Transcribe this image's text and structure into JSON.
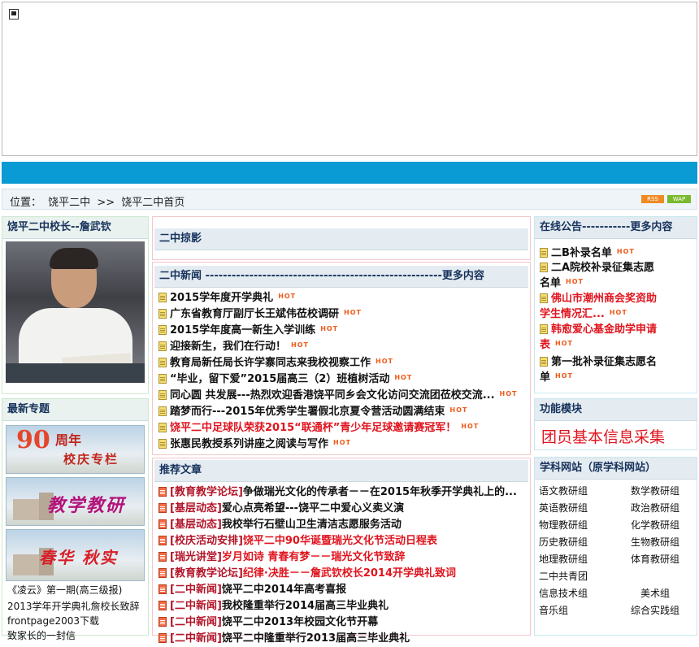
{
  "breadcrumb": {
    "label": "位置：",
    "home": "饶平二中",
    "sep": ">>",
    "current": "饶平二中首页"
  },
  "badges": {
    "rss": "RSS",
    "wap": "WAP"
  },
  "left": {
    "principal_title": "饶平二中校长--詹武钦",
    "special_title": "最新专题",
    "banners": [
      {
        "big": "90",
        "small": "周年",
        "small2": "校庆专栏"
      },
      {
        "text": "教学教研"
      },
      {
        "text": "春华 秋实"
      }
    ],
    "links": [
      "《凌云》第一期(高三级报)",
      "2013学年开学典礼詹校长致辞",
      "frontpage2003下载",
      "致家长的一封信"
    ]
  },
  "middle": {
    "photo_title": "二中掠影",
    "news_title": "二中新闻  ------------------------------------------------------更多内容",
    "hot": "HOT",
    "news": [
      {
        "text": "2015学年度开学典礼",
        "red": false
      },
      {
        "text": "广东省教育厅副厅长王斌伟莅校调研",
        "red": false
      },
      {
        "text": "2015学年度高一新生入学训练",
        "red": false
      },
      {
        "text": "迎接新生，我们在行动！",
        "red": false
      },
      {
        "text": "教育局新任局长许学寨同志来我校视察工作",
        "red": false
      },
      {
        "text": "“毕业，留下爱”2015届高三（2）班植树活动",
        "red": false
      },
      {
        "text": "同心圆 共发展---热烈欢迎香港饶平同乡会文化访问交流团莅校交流...",
        "red": false
      },
      {
        "text": "踏梦而行---2015年优秀学生署假北京夏令营活动圆满结束",
        "red": false
      },
      {
        "text": "饶平二中足球队荣获2015“联通杯”青少年足球邀请赛冠军！",
        "red": true
      },
      {
        "text": "张惠民教授系列讲座之阅读与写作",
        "red": false
      }
    ],
    "rec_title": "推荐文章",
    "recommended": [
      {
        "cat": "[教育教学论坛]",
        "text": "争做瑞光文化的传承者－－在2015年秋季开学典礼上的...",
        "red": false
      },
      {
        "cat": "[基层动态]",
        "text": "爱心点亮希望---饶平二中爱心义卖义演",
        "red": false
      },
      {
        "cat": "[基层动态]",
        "text": "我校举行石壁山卫生清洁志愿服务活动",
        "red": false
      },
      {
        "cat": "[校庆活动安排]",
        "text": "饶平二中90华诞暨瑞光文化节活动日程表",
        "red": true
      },
      {
        "cat": "[瑞光讲堂]",
        "text": "岁月如诗  青春有梦－－瑞光文化节致辞",
        "red": true
      },
      {
        "cat": "[教育教学论坛]",
        "text": "纪律·决胜－－詹武钦校长2014开学典礼致词",
        "red": true
      },
      {
        "cat": "[二中新闻]",
        "text": "饶平二中2014年高考喜报",
        "red": false
      },
      {
        "cat": "[二中新闻]",
        "text": "我校隆重举行2014届高三毕业典礼",
        "red": false
      },
      {
        "cat": "[二中新闻]",
        "text": "饶平二中2013年校园文化节开幕",
        "red": false
      },
      {
        "cat": "[二中新闻]",
        "text": "饶平二中隆重举行2013届高三毕业典礼",
        "red": false
      }
    ]
  },
  "right": {
    "notice_title": "在线公告-----------更多内容",
    "notices": [
      {
        "text": "二B补录名单",
        "red": false
      },
      {
        "text": "二A院校补录征集志愿名单",
        "red": false
      },
      {
        "text": "佛山市潮州商会奖资助学生情况汇...",
        "red": true
      },
      {
        "text": "韩愈爱心基金助学申请表",
        "red": true
      },
      {
        "text": "第一批补录征集志愿名单",
        "red": false
      }
    ],
    "func_title": "功能模块",
    "func_link": "团员基本信息采集",
    "subject_title": "学科网站（原学科网站）",
    "subjects": [
      [
        "语文教研组",
        "数学教研组"
      ],
      [
        "英语教研组",
        "政治教研组"
      ],
      [
        "物理教研组",
        "化学教研组"
      ],
      [
        "历史教研组",
        "生物教研组"
      ],
      [
        "地理教研组",
        "体育教研组"
      ],
      [
        "二中共青团",
        ""
      ],
      [
        "信息技术组",
        "美术组"
      ],
      [
        "音乐组",
        "综合实践组"
      ]
    ]
  }
}
